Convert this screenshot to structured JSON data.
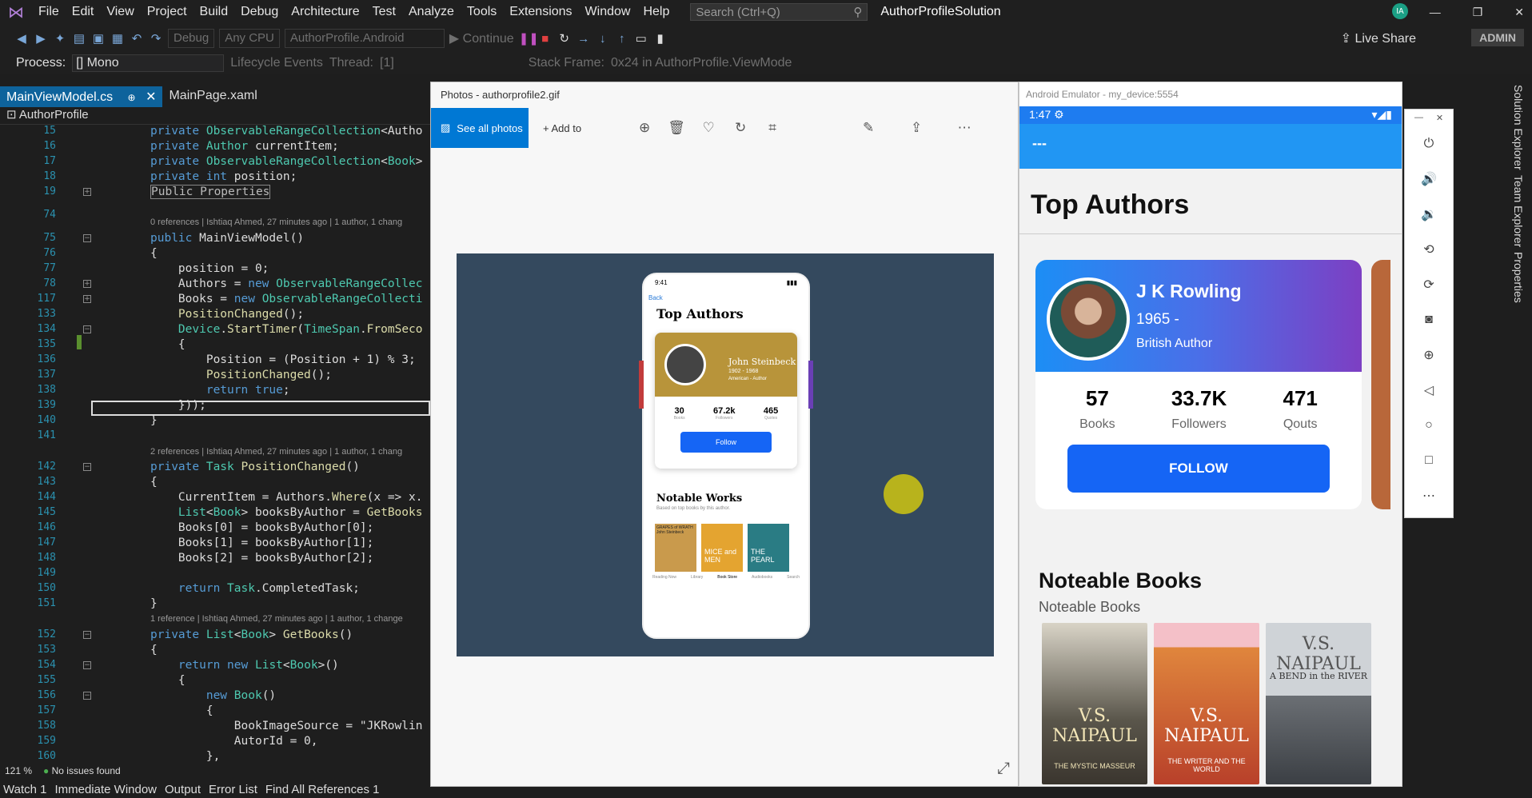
{
  "menubar": {
    "items": [
      "File",
      "Edit",
      "View",
      "Project",
      "Build",
      "Debug",
      "Architecture",
      "Test",
      "Analyze",
      "Tools",
      "Extensions",
      "Window",
      "Help"
    ],
    "search_placeholder": "Search (Ctrl+Q)",
    "solution_title": "AuthorProfileSolution",
    "user_initials": "IA"
  },
  "toolbar": {
    "config": "Debug",
    "platform": "Any CPU",
    "project": "AuthorProfile.Android",
    "continue_label": "Continue",
    "live_share": "Live Share",
    "admin": "ADMIN"
  },
  "processbar": {
    "process_label": "Process:",
    "process_value": "[] Mono",
    "lifecycle": "Lifecycle Events",
    "thread_label": "Thread:",
    "thread_value": "[1]",
    "stack_label": "Stack Frame:",
    "stack_value": "0x24 in AuthorProfile.ViewMode"
  },
  "tabs": [
    {
      "label": "MainViewModel.cs",
      "active": true
    },
    {
      "label": "MainPage.xaml",
      "active": false
    }
  ],
  "navbar": {
    "label": "AuthorProfile"
  },
  "code_lines": [
    {
      "n": "15",
      "text": "private ObservableRangeCollection<Autho"
    },
    {
      "n": "16",
      "text": "private Author currentItem;"
    },
    {
      "n": "17",
      "text": "private ObservableRangeCollection<Book>"
    },
    {
      "n": "18",
      "text": "private int position;"
    },
    {
      "n": "19",
      "text": "Public Properties"
    },
    {
      "n": "74",
      "text": ""
    },
    {
      "n": "75",
      "text": "public MainViewModel()"
    },
    {
      "n": "76",
      "text": "{"
    },
    {
      "n": "77",
      "text": "    position = 0;"
    },
    {
      "n": "78",
      "text": "    Authors = new ObservableRangeCollec"
    },
    {
      "n": "117",
      "text": "    Books = new ObservableRangeCollecti"
    },
    {
      "n": "133",
      "text": "    PositionChanged();"
    },
    {
      "n": "134",
      "text": "    Device.StartTimer(TimeSpan.FromSeco"
    },
    {
      "n": "135",
      "text": "    {"
    },
    {
      "n": "136",
      "text": "        Position = (Position + 1) % 3;"
    },
    {
      "n": "137",
      "text": "        PositionChanged();"
    },
    {
      "n": "138",
      "text": "        return true;"
    },
    {
      "n": "139",
      "text": "    }));"
    },
    {
      "n": "140",
      "text": "}"
    },
    {
      "n": "141",
      "text": ""
    },
    {
      "n": "142",
      "text": "private Task PositionChanged()"
    },
    {
      "n": "143",
      "text": "{"
    },
    {
      "n": "144",
      "text": "    CurrentItem = Authors.Where(x => x."
    },
    {
      "n": "145",
      "text": "    List<Book> booksByAuthor = GetBooks"
    },
    {
      "n": "146",
      "text": "    Books[0] = booksByAuthor[0];"
    },
    {
      "n": "147",
      "text": "    Books[1] = booksByAuthor[1];"
    },
    {
      "n": "148",
      "text": "    Books[2] = booksByAuthor[2];"
    },
    {
      "n": "149",
      "text": ""
    },
    {
      "n": "150",
      "text": "    return Task.CompletedTask;"
    },
    {
      "n": "151",
      "text": "}"
    },
    {
      "n": "152",
      "text": "private List<Book> GetBooks()"
    },
    {
      "n": "153",
      "text": "{"
    },
    {
      "n": "154",
      "text": "    return new List<Book>()"
    },
    {
      "n": "155",
      "text": "    {"
    },
    {
      "n": "156",
      "text": "        new Book()"
    },
    {
      "n": "157",
      "text": "        {"
    },
    {
      "n": "158",
      "text": "            BookImageSource = \"JKRowlin"
    },
    {
      "n": "159",
      "text": "            AutorId = 0,"
    },
    {
      "n": "160",
      "text": "        },"
    }
  ],
  "codelens": [
    "0 references | Ishtiaq Ahmed, 27 minutes ago | 1 author, 1 chang",
    "2 references | Ishtiaq Ahmed, 27 minutes ago | 1 author, 1 chang",
    "1 reference | Ishtiaq Ahmed, 27 minutes ago | 1 author, 1 change"
  ],
  "statusline": {
    "zoom": "121 %",
    "issues": "No issues found"
  },
  "bottomtabs": [
    "Watch 1",
    "Immediate Window",
    "Output",
    "Error List",
    "Find All References 1"
  ],
  "photos": {
    "title": "Photos - authorprofile2.gif",
    "see_all": "See all photos",
    "add_to": "Add to",
    "mock": {
      "time": "9:41",
      "back": "Back",
      "heading": "Top Authors",
      "author_name": "John Steinbeck",
      "author_years": "1902 - 1968",
      "author_role": "American - Author",
      "stats": [
        {
          "value": "30",
          "label": "Books"
        },
        {
          "value": "67.2k",
          "label": "Followers"
        },
        {
          "value": "465",
          "label": "Quotes"
        }
      ],
      "follow": "Follow",
      "works_title": "Notable Works",
      "works_sub": "Based on top books by this author.",
      "book_covers": [
        "GRAPES of WRATH John Steinbeck",
        "MICE and MEN",
        "THE PEARL"
      ],
      "nav": [
        "Reading Now",
        "Library",
        "Book Store",
        "Audiobooks",
        "Search"
      ]
    }
  },
  "emulator": {
    "title": "Android Emulator - my_device:5554",
    "time": "1:47",
    "appbar": "---",
    "heading": "Top Authors",
    "author": {
      "name": "J K Rowling",
      "years": "1965 -",
      "role": "British Author"
    },
    "stats": [
      {
        "value": "57",
        "label": "Books"
      },
      {
        "value": "33.7K",
        "label": "Followers"
      },
      {
        "value": "471",
        "label": "Qouts"
      }
    ],
    "follow": "FOLLOW",
    "books_title": "Noteable Books",
    "books_sub": "Noteable Books",
    "books": [
      {
        "author": "V.S. NAIPAUL",
        "title": "THE MYSTIC MASSEUR"
      },
      {
        "author": "V.S. NAIPAUL",
        "title": "THE WRITER AND THE WORLD"
      },
      {
        "author": "V.S. NAIPAUL",
        "title": "A BEND in the RIVER"
      }
    ]
  },
  "right_rail": [
    "Solution Explorer",
    "Team Explorer",
    "Properties"
  ],
  "colors": {
    "accent": "#0e639c",
    "follow_blue": "#1565f5",
    "appbar": "#2196f3",
    "stage": "#34495e"
  }
}
